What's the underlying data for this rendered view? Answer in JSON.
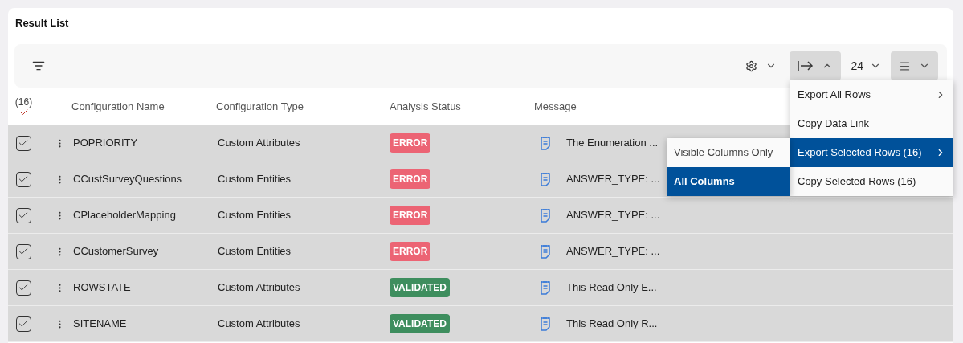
{
  "title": "Result List",
  "toolbar": {
    "export_expanded": true,
    "page_size": "24"
  },
  "selection": {
    "count": "(16)",
    "all_checked": true
  },
  "columns": [
    "Configuration Name",
    "Configuration Type",
    "Analysis Status",
    "Message"
  ],
  "rows": [
    {
      "checked": true,
      "name": "POPRIORITY",
      "type": "Custom Attributes",
      "status": {
        "label": "ERROR",
        "kind": "error"
      },
      "message": "The Enumeration ..."
    },
    {
      "checked": true,
      "name": "CCustSurveyQuestions",
      "type": "Custom Entities",
      "status": {
        "label": "ERROR",
        "kind": "error"
      },
      "message": "ANSWER_TYPE: ..."
    },
    {
      "checked": true,
      "name": "CPlaceholderMapping",
      "type": "Custom Entities",
      "status": {
        "label": "ERROR",
        "kind": "error"
      },
      "message": "ANSWER_TYPE: ..."
    },
    {
      "checked": true,
      "name": "CCustomerSurvey",
      "type": "Custom Entities",
      "status": {
        "label": "ERROR",
        "kind": "error"
      },
      "message": "ANSWER_TYPE: ..."
    },
    {
      "checked": true,
      "name": "ROWSTATE",
      "type": "Custom Attributes",
      "status": {
        "label": "VALIDATED",
        "kind": "validated"
      },
      "message": "This Read Only E..."
    },
    {
      "checked": true,
      "name": "SITENAME",
      "type": "Custom Attributes",
      "status": {
        "label": "VALIDATED",
        "kind": "validated"
      },
      "message": "This Read Only R..."
    }
  ],
  "export_menu": [
    {
      "label": "Export All Rows",
      "has_submenu": true,
      "selected": false
    },
    {
      "label": "Copy Data Link",
      "has_submenu": false,
      "selected": false
    },
    {
      "label": "Export Selected Rows (16)",
      "has_submenu": true,
      "selected": true
    },
    {
      "label": "Copy Selected Rows (16)",
      "has_submenu": false,
      "selected": false
    }
  ],
  "submenu": [
    {
      "label": "Visible Columns Only",
      "selected": false
    },
    {
      "label": "All Columns",
      "selected": true
    }
  ]
}
